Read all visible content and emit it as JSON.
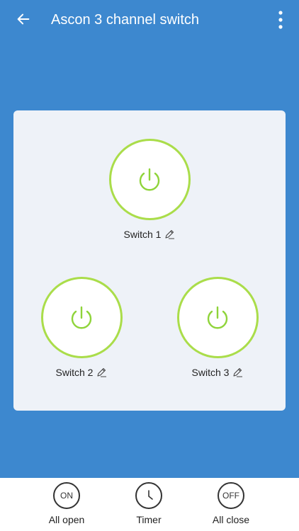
{
  "app_bar": {
    "title": "Ascon 3 channel switch",
    "back_icon": "arrow-left-icon",
    "more_icon": "more-vertical-icon"
  },
  "colors": {
    "background": "#3d88cf",
    "panel": "#eef2f8",
    "switch_ring": "#aadd4a",
    "power_icon": "#8fd43a"
  },
  "switches": [
    {
      "label": "Switch 1",
      "state": "off"
    },
    {
      "label": "Switch 2",
      "state": "off"
    },
    {
      "label": "Switch 3",
      "state": "off"
    }
  ],
  "actions": {
    "all_open": {
      "icon_text": "ON",
      "label": "All open"
    },
    "timer": {
      "label": "Timer",
      "icon": "clock-icon"
    },
    "all_close": {
      "icon_text": "OFF",
      "label": "All close"
    }
  }
}
